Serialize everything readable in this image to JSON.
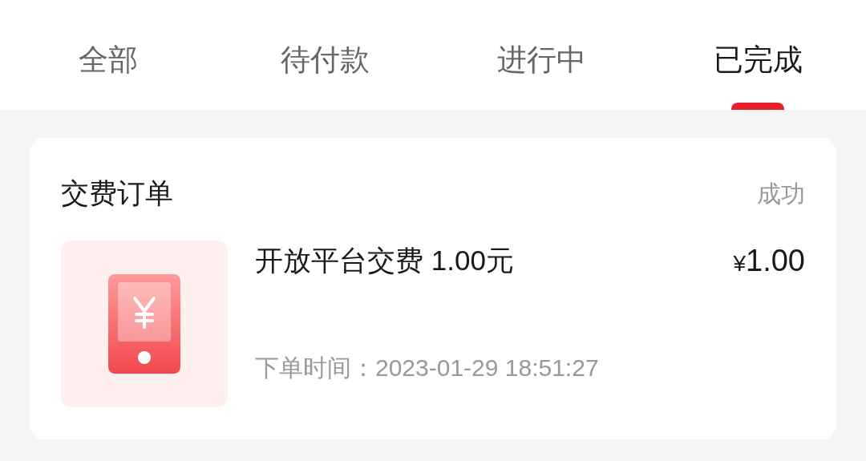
{
  "tabs": [
    {
      "label": "全部",
      "selected": false
    },
    {
      "label": "待付款",
      "selected": false
    },
    {
      "label": "进行中",
      "selected": false
    },
    {
      "label": "已完成",
      "selected": true
    }
  ],
  "order": {
    "title": "交费订单",
    "status": "成功",
    "item": {
      "name": "开放平台交费 1.00元",
      "currency": "¥",
      "price": "1.00",
      "time": "下单时间：2023-01-29 18:51:27"
    }
  }
}
